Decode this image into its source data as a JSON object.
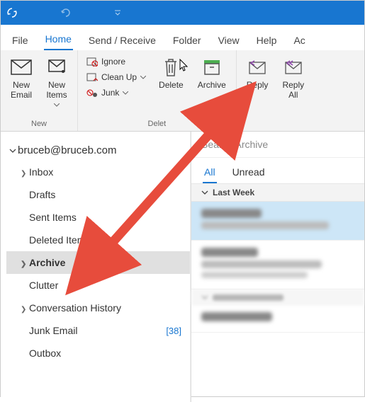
{
  "tabs": {
    "file": "File",
    "home": "Home",
    "sendreceive": "Send / Receive",
    "folder": "Folder",
    "view": "View",
    "help": "Help",
    "account": "Ac"
  },
  "ribbon": {
    "newemail": "New\nEmail",
    "newitems": "New\nItems",
    "group_new": "New",
    "ignore": "Ignore",
    "cleanup": "Clean Up",
    "junk": "Junk",
    "delete": "Delete",
    "archive": "Archive",
    "group_delete": "Delet",
    "reply": "Reply",
    "replyall": "Reply\nAll"
  },
  "account": "bruceb@bruceb.com",
  "folders": {
    "inbox": "Inbox",
    "drafts": "Drafts",
    "sent": "Sent Items",
    "deleted": "Deleted Items",
    "archive": "Archive",
    "clutter": "Clutter",
    "convo": "Conversation History",
    "junk": "Junk Email",
    "junk_count": "[38]",
    "outbox": "Outbox"
  },
  "msglist": {
    "search_placeholder": "Search Archive",
    "filter_all": "All",
    "filter_unread": "Unread",
    "group1": "Last Week"
  }
}
